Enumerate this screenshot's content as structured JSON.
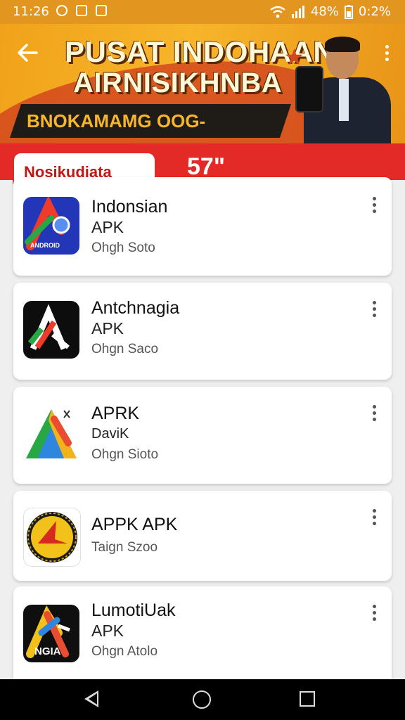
{
  "status_bar": {
    "time": "11:26",
    "battery": "48%",
    "data_usage": "0:2%"
  },
  "banner": {
    "title_line1": "PUSAT INDOHAAN",
    "title_line2": "AIRNISIKHNBA",
    "tagline": "BNOKAMAMG OOG-INDADEKS",
    "back_icon": "arrow-left-icon",
    "menu_icon": "more-vertical-icon"
  },
  "tabs": {
    "active_label": "Nosikudiata",
    "count_label": "57\""
  },
  "apps": [
    {
      "name": "Indonsian",
      "line2": "APK",
      "meta": "Ohgh Soto",
      "icon_text": "ANDROID",
      "icon": "app-icon-indonsian"
    },
    {
      "name": "Antchnagia",
      "line2": "APK",
      "meta": "Ohgn Saco",
      "icon_text": "",
      "icon": "app-icon-antchnagia"
    },
    {
      "name": "APRK",
      "line2": "DaviK",
      "meta": "Ohgn Sioto",
      "icon_text": "",
      "icon": "app-icon-aprk"
    },
    {
      "name": "APPK APK",
      "line2": "",
      "meta": "Taign Szoo",
      "icon_text": "",
      "icon": "app-icon-appk"
    },
    {
      "name": "LumotiUak",
      "line2": "APK",
      "meta": "Ohgn Atolo",
      "icon_text": "NGIA",
      "icon": "app-icon-lumotiuak"
    }
  ],
  "nav": {
    "back_icon": "nav-back-icon",
    "home_icon": "nav-home-icon",
    "recent_icon": "nav-recent-icon"
  },
  "colors": {
    "brand_orange": "#e3961f",
    "brand_red": "#e32a26"
  }
}
